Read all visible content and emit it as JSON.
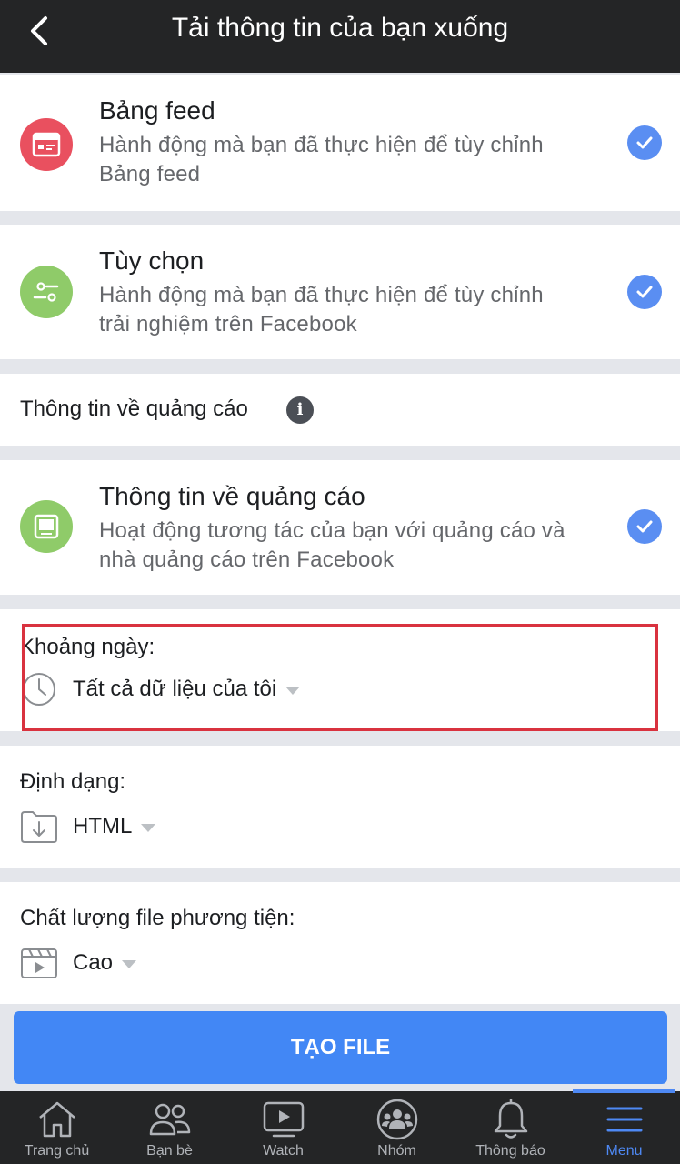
{
  "header": {
    "title": "Tải thông tin của bạn xuống",
    "back_icon": "chevron-left-icon"
  },
  "categories": [
    {
      "title": "Bảng feed",
      "desc_lines": [
        "Hành động mà bạn đã thực hiện để tùy chỉnh",
        "Bảng feed"
      ],
      "icon": "feed-icon",
      "icon_color": "#e9505f",
      "checked": true
    },
    {
      "title": "Tùy chọn",
      "desc_lines": [
        "Hành động mà bạn đã thực hiện để tùy chỉnh",
        "trải nghiệm trên Facebook"
      ],
      "icon": "sliders-icon",
      "icon_color": "#8fcb69",
      "checked": true
    },
    {
      "title": "Thông tin về quảng cáo",
      "desc_lines": [
        "Hoạt động tương tác của bạn với quảng cáo và",
        "nhà quảng cáo trên Facebook"
      ],
      "icon": "ad-screen-icon",
      "icon_color": "#8fcb69",
      "checked": true
    }
  ],
  "ads_section": {
    "label": "Thông tin về quảng cáo",
    "info_icon": "i"
  },
  "date_range": {
    "label": "Khoảng ngày:",
    "value": "Tất cả dữ liệu của tôi",
    "icon": "clock-icon"
  },
  "format": {
    "label": "Định dạng:",
    "value": "HTML",
    "icon": "folder-download-icon"
  },
  "media_quality": {
    "label": "Chất lượng file phương tiện:",
    "value": "Cao",
    "icon": "clapperboard-icon"
  },
  "create_button": {
    "label": "TẠO FILE"
  },
  "tabs": [
    {
      "label": "Trang chủ",
      "icon": "home-icon",
      "active": false
    },
    {
      "label": "Bạn bè",
      "icon": "friends-icon",
      "active": false
    },
    {
      "label": "Watch",
      "icon": "watch-icon",
      "active": false
    },
    {
      "label": "Nhóm",
      "icon": "groups-icon",
      "active": false
    },
    {
      "label": "Thông báo",
      "icon": "bell-icon",
      "active": false
    },
    {
      "label": "Menu",
      "icon": "menu-icon",
      "active": true
    }
  ],
  "colors": {
    "accent": "#4287f5",
    "header_bg": "#242526",
    "highlight": "#d9323f",
    "check": "#5a8ef2"
  }
}
